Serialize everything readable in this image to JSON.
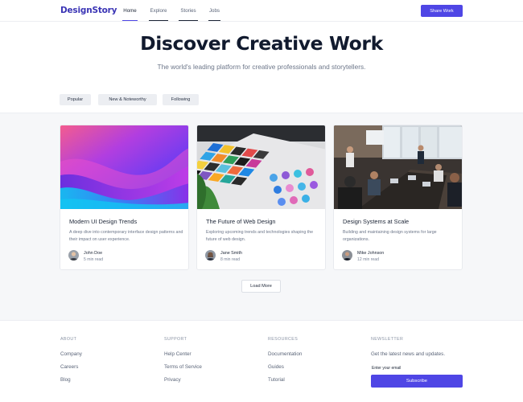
{
  "header": {
    "logo": "DesignStory",
    "nav": [
      "Home",
      "Explore",
      "Stories",
      "Jobs"
    ],
    "active_nav": "Home",
    "cta": "Share Work"
  },
  "hero": {
    "title": "Discover Creative Work",
    "subtitle": "The world's leading platform for creative professionals and storytellers.",
    "filters": [
      "Popular",
      "New & Noteworthy",
      "Following"
    ]
  },
  "cards": [
    {
      "image": "abstract-purple-waves-image",
      "title": "Modern UI Design Trends",
      "description": "A deep dive into contemporary interface design patterns and their impact on user experience.",
      "author": "John Doe",
      "read_time": "5 min read"
    },
    {
      "image": "color-swatches-on-table-image",
      "title": "The Future of Web Design",
      "description": "Exploring upcoming trends and technologies shaping the future of web design.",
      "author": "Jane Smith",
      "read_time": "8 min read"
    },
    {
      "image": "conference-meeting-room-image",
      "title": "Design Systems at Scale",
      "description": "Building and maintaining design systems for large organizations.",
      "author": "Mike Johnson",
      "read_time": "12 min read"
    }
  ],
  "load_more": "Load More",
  "footer": {
    "columns": [
      {
        "heading": "ABOUT",
        "links": [
          "Company",
          "Careers",
          "Blog"
        ]
      },
      {
        "heading": "SUPPORT",
        "links": [
          "Help Center",
          "Terms of Service",
          "Privacy"
        ]
      },
      {
        "heading": "RESOURCES",
        "links": [
          "Documentation",
          "Guides",
          "Tutorial"
        ]
      }
    ],
    "newsletter": {
      "heading": "NEWSLETTER",
      "text": "Get the latest news and updates.",
      "placeholder": "Enter your email",
      "button": "Subscribe"
    }
  },
  "colors": {
    "brand": "#4f46e5",
    "logo": "#3b35b5",
    "text_dark": "#1c2536",
    "text_muted": "#6c7689",
    "page_bg": "#f6f7f9"
  }
}
